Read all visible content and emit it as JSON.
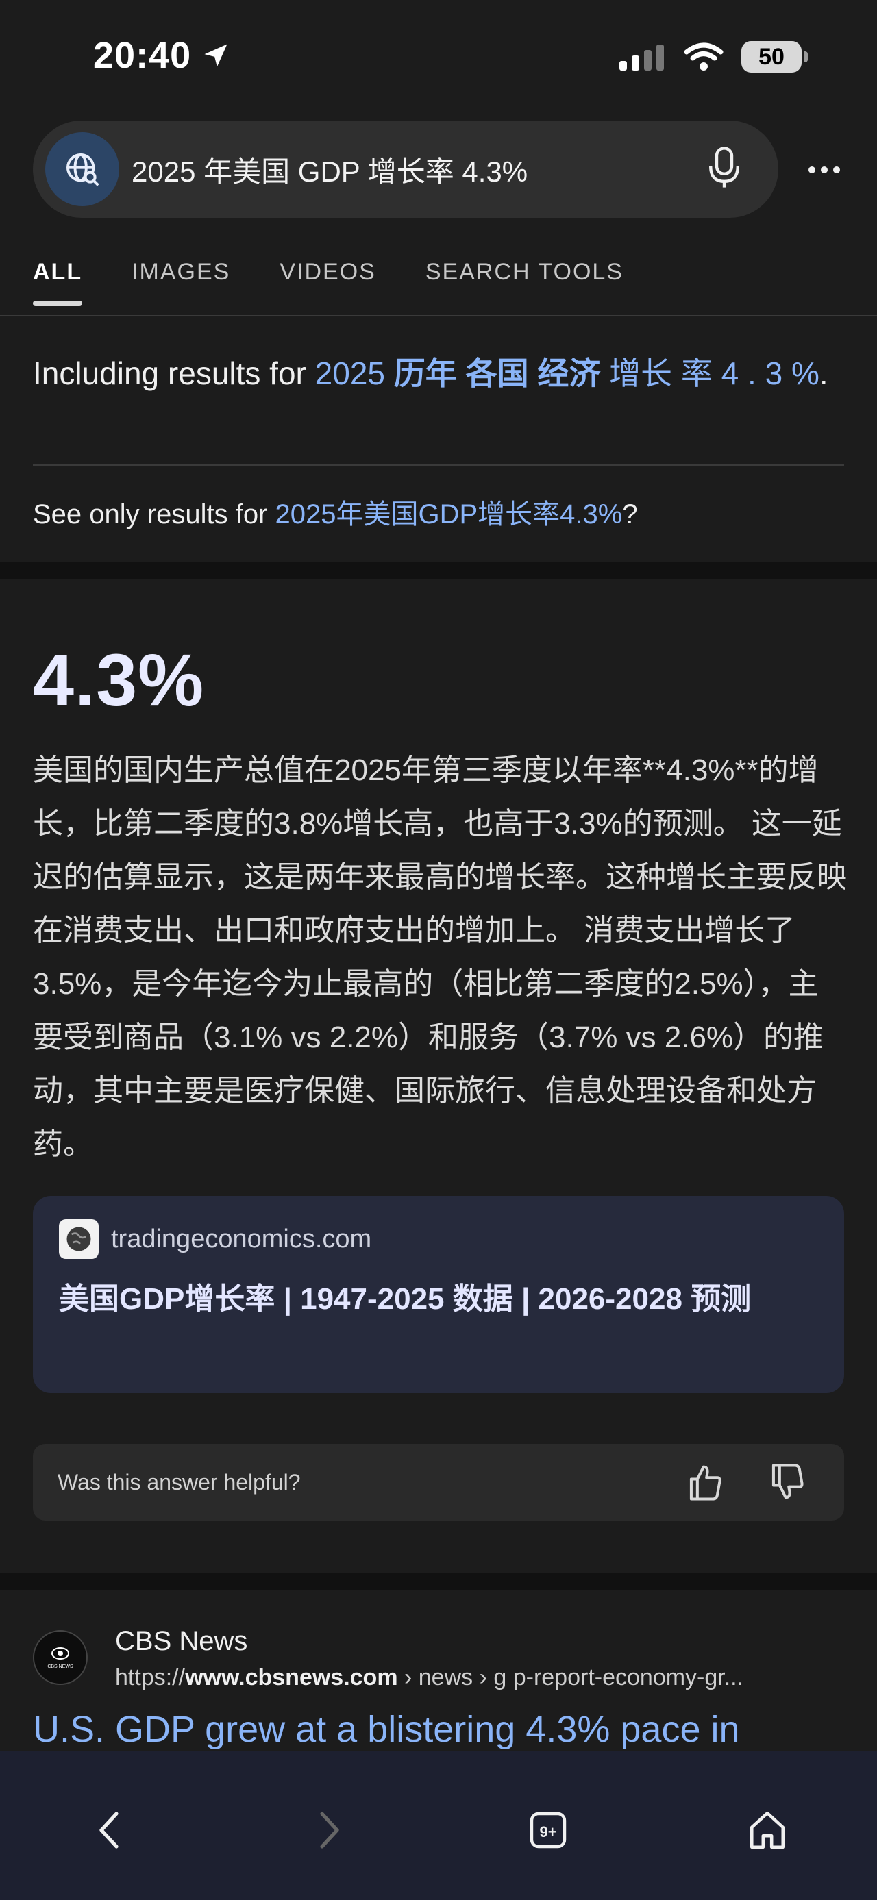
{
  "status": {
    "time": "20:40",
    "battery": "50"
  },
  "search": {
    "query": "2025 年美国 GDP 增长率 4.3%"
  },
  "tabs": [
    {
      "label": "ALL",
      "active": true
    },
    {
      "label": "IMAGES"
    },
    {
      "label": "VIDEOS"
    },
    {
      "label": "SEARCH TOOLS"
    }
  ],
  "spelling": {
    "including_prefix": "Including results for ",
    "including_link_parts": [
      "2025 ",
      "历年",
      " ",
      "各国",
      " ",
      "经济",
      " 增长 率 4 . 3 %"
    ],
    "including_suffix": ".",
    "see_only_prefix": "See only results for ",
    "see_only_link": "2025年美国GDP增长率4.3%",
    "see_only_suffix": "?"
  },
  "answer": {
    "value": "4.3%",
    "text": "美国的国内生产总值在2025年第三季度以年率**4.3%**的增长，比第二季度的3.8%增长高，也高于3.3%的预测。 这一延迟的估算显示，这是两年来最高的增长率。这种增长主要反映在消费支出、出口和政府支出的增加上。 消费支出增长了3.5%，是今年迄今为止最高的（相比第二季度的2.5%），主要受到商品（3.1% vs 2.2%）和服务（3.7% vs 2.6%）的推动，其中主要是医疗保健、国际旅行、信息处理设备和处方药。",
    "source_domain": "tradingeconomics.com",
    "source_title": "美国GDP增长率 | 1947-2025 数据 | 2026-2028 预测",
    "helpful_question": "Was this answer helpful?"
  },
  "result": {
    "source": "CBS News",
    "url_prefix": "https://",
    "url_domain": "www.cbsnews.com",
    "url_path": " › news › g   p-report-economy-gr...",
    "logo_text": "CBS NEWS",
    "title": "U.S. GDP grew at a blistering 4.3% pace in"
  },
  "toolbar": {
    "tabs_count": "9+"
  },
  "colors": {
    "link": "#8ab4f8",
    "card": "#262a3c",
    "bottom_bar": "#1d2030"
  }
}
